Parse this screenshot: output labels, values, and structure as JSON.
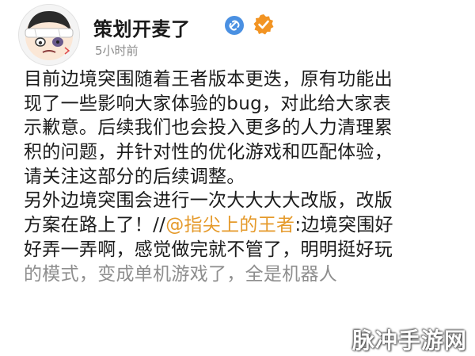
{
  "author": {
    "name": "策划开麦了",
    "time": "5小时前",
    "avatar_icon": "cartoon-avatar-bandaged",
    "badges": [
      "link-icon",
      "verified-badge-icon"
    ]
  },
  "post": {
    "line1": "目前边境突围随着王者版本更迭，原有功能出",
    "line2": "现了一些影响大家体验的bug，对此给大家表",
    "line3": "示歉意。后续我们也会投入更多的人力清理累",
    "line4": "积的问题，并针对性的优化游戏和匹配体验，",
    "line5": "请关注这部分的后续调整。",
    "line6": "另外边境突围会进行一次大大大大改版，改版",
    "line7_prefix": "方案在路上了！//",
    "mention": "@指尖上的王者",
    "line7_suffix": ":边境突围好",
    "line8": "好弄一弄啊，感觉做完就不管了，明明挺好玩",
    "line9": "的模式，变成单机游戏了，全是机器人"
  },
  "watermark": "脉冲手游网",
  "colors": {
    "mention": "#e59a2b",
    "link_badge": "#4a90e2",
    "verified_badge": "#f29423",
    "timestamp": "#8c8c8c"
  }
}
